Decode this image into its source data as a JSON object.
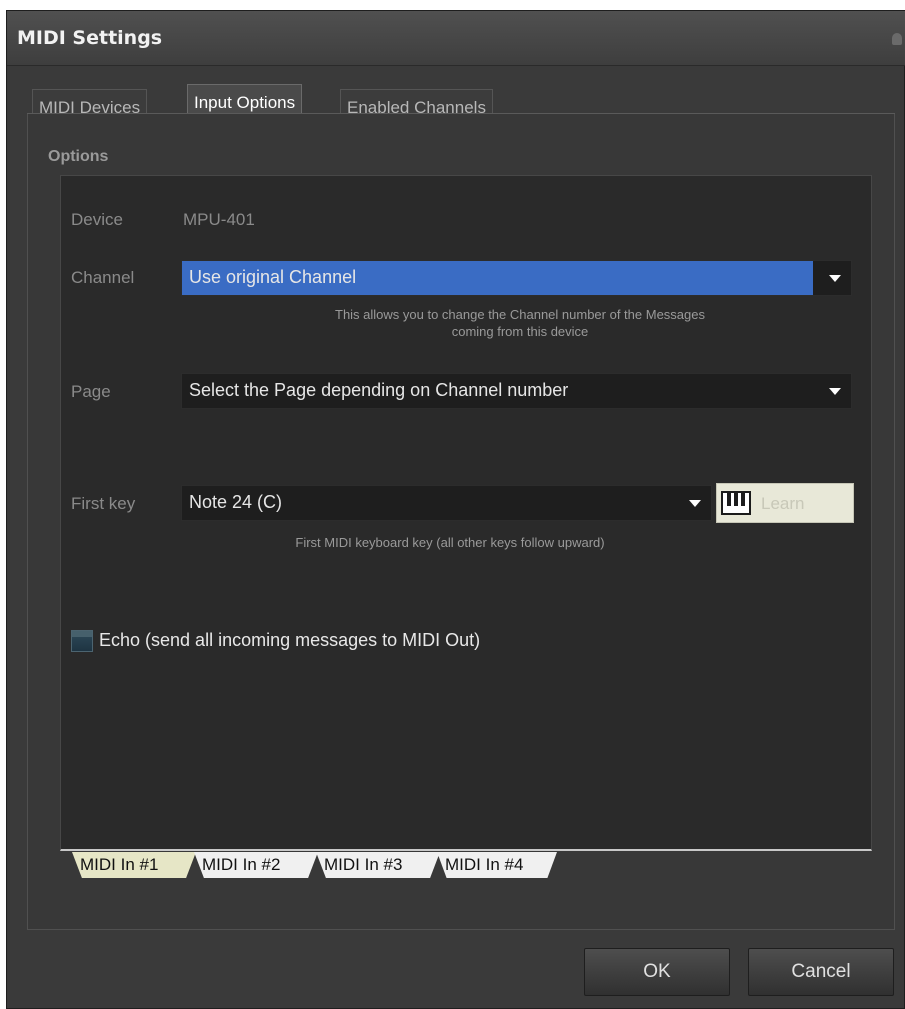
{
  "window": {
    "title": "MIDI Settings",
    "title_icon": "pin-icon"
  },
  "tabs": [
    {
      "label": "MIDI Devices",
      "active": false
    },
    {
      "label": "Input Options",
      "active": true
    },
    {
      "label": "Enabled Channels",
      "active": false
    }
  ],
  "options": {
    "group_title": "Options",
    "device_label": "Device",
    "device_value": "MPU-401",
    "channel_label": "Channel",
    "channel_value": "Use original Channel",
    "channel_hint_line1": "This allows you to change the Channel number of the Messages",
    "channel_hint_line2": "coming from this device",
    "page_label": "Page",
    "page_value": "Select the Page depending on Channel number",
    "first_key_label": "First key",
    "first_key_value": "Note 24 (C)",
    "learn_label": "Learn",
    "learn_icon": "piano-keyboard-icon",
    "first_key_hint": "First MIDI keyboard key (all other keys follow upward)",
    "echo_label": "Echo (send all incoming messages to MIDI Out)",
    "echo_checked": false
  },
  "input_tabs": [
    {
      "label": "MIDI In #1",
      "active": true
    },
    {
      "label": "MIDI In #2",
      "active": false
    },
    {
      "label": "MIDI In #3",
      "active": false
    },
    {
      "label": "MIDI In #4",
      "active": false
    }
  ],
  "buttons": {
    "ok": "OK",
    "cancel": "Cancel"
  },
  "colors": {
    "selection": "#3a6cc4",
    "background": "#3a3a3a",
    "field": "#1e1e1e"
  }
}
